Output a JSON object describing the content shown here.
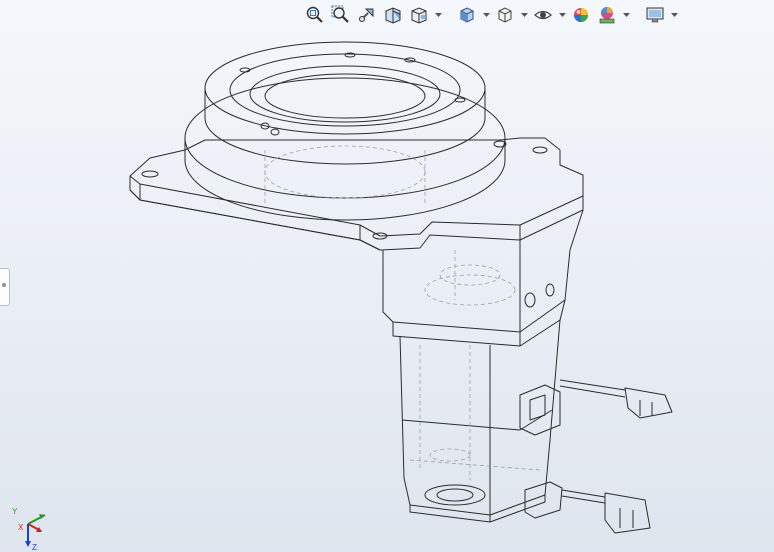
{
  "toolbar": {
    "tools": [
      {
        "name": "zoom-to-fit",
        "icon": "magnifier-fit-icon"
      },
      {
        "name": "zoom-to-area",
        "icon": "magnifier-area-icon"
      },
      {
        "name": "previous-view",
        "icon": "previous-view-icon"
      },
      {
        "name": "section-view",
        "icon": "section-view-icon"
      },
      {
        "name": "dynamic-annotation",
        "icon": "annotation-view-icon",
        "has_dropdown": true
      },
      {
        "name": "view-orientation",
        "icon": "cube-orientation-icon",
        "has_dropdown": true
      },
      {
        "name": "display-style",
        "icon": "display-style-icon",
        "has_dropdown": true
      },
      {
        "name": "hide-show-items",
        "icon": "eye-icon",
        "has_dropdown": true
      },
      {
        "name": "edit-appearance",
        "icon": "appearance-sphere-icon"
      },
      {
        "name": "apply-scene",
        "icon": "scene-icon",
        "has_dropdown": true
      },
      {
        "name": "view-settings",
        "icon": "monitor-icon",
        "has_dropdown": true
      }
    ]
  },
  "triad": {
    "x_label": "X",
    "y_label": "Y",
    "z_label": "Z",
    "x_color": "#d21f1f",
    "y_color": "#1f9a1f",
    "z_color": "#1f3fd2"
  },
  "model": {
    "display_mode": "hidden-lines-visible",
    "line_color": "#2b2b2b",
    "hidden_line_color": "#9aa0a8"
  }
}
